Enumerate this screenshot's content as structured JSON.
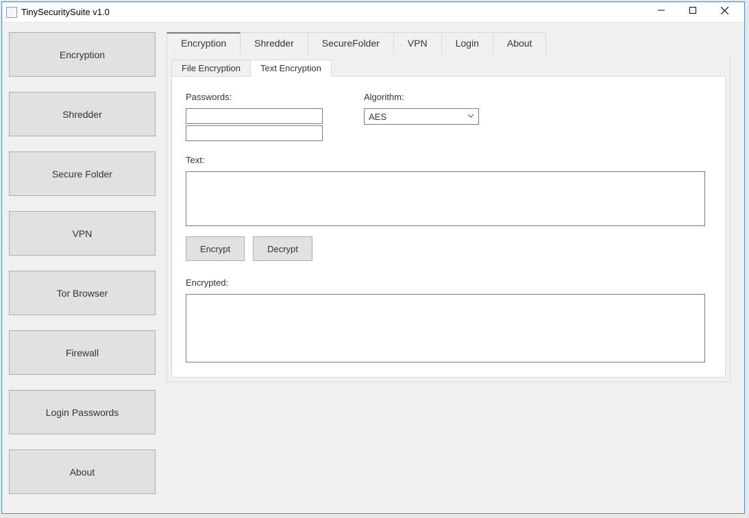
{
  "window": {
    "title": "TinySecuritySuite v1.0"
  },
  "sidebar": {
    "items": [
      {
        "label": "Encryption"
      },
      {
        "label": "Shredder"
      },
      {
        "label": "Secure Folder"
      },
      {
        "label": "VPN"
      },
      {
        "label": "Tor Browser"
      },
      {
        "label": "Firewall"
      },
      {
        "label": "Login Passwords"
      },
      {
        "label": "About"
      }
    ]
  },
  "tabs": {
    "items": [
      {
        "label": "Encryption",
        "active": true
      },
      {
        "label": "Shredder"
      },
      {
        "label": "SecureFolder"
      },
      {
        "label": "VPN"
      },
      {
        "label": "Login"
      },
      {
        "label": "About"
      }
    ]
  },
  "subtabs": {
    "items": [
      {
        "label": "File Encryption"
      },
      {
        "label": "Text Encryption",
        "active": true
      }
    ]
  },
  "form": {
    "passwords_label": "Passwords:",
    "password1": "",
    "password2": "",
    "algorithm_label": "Algorithm:",
    "algorithm_value": "AES",
    "text_label": "Text:",
    "text_value": "",
    "encrypt_btn": "Encrypt",
    "decrypt_btn": "Decrypt",
    "encrypted_label": "Encrypted:",
    "encrypted_value": ""
  }
}
